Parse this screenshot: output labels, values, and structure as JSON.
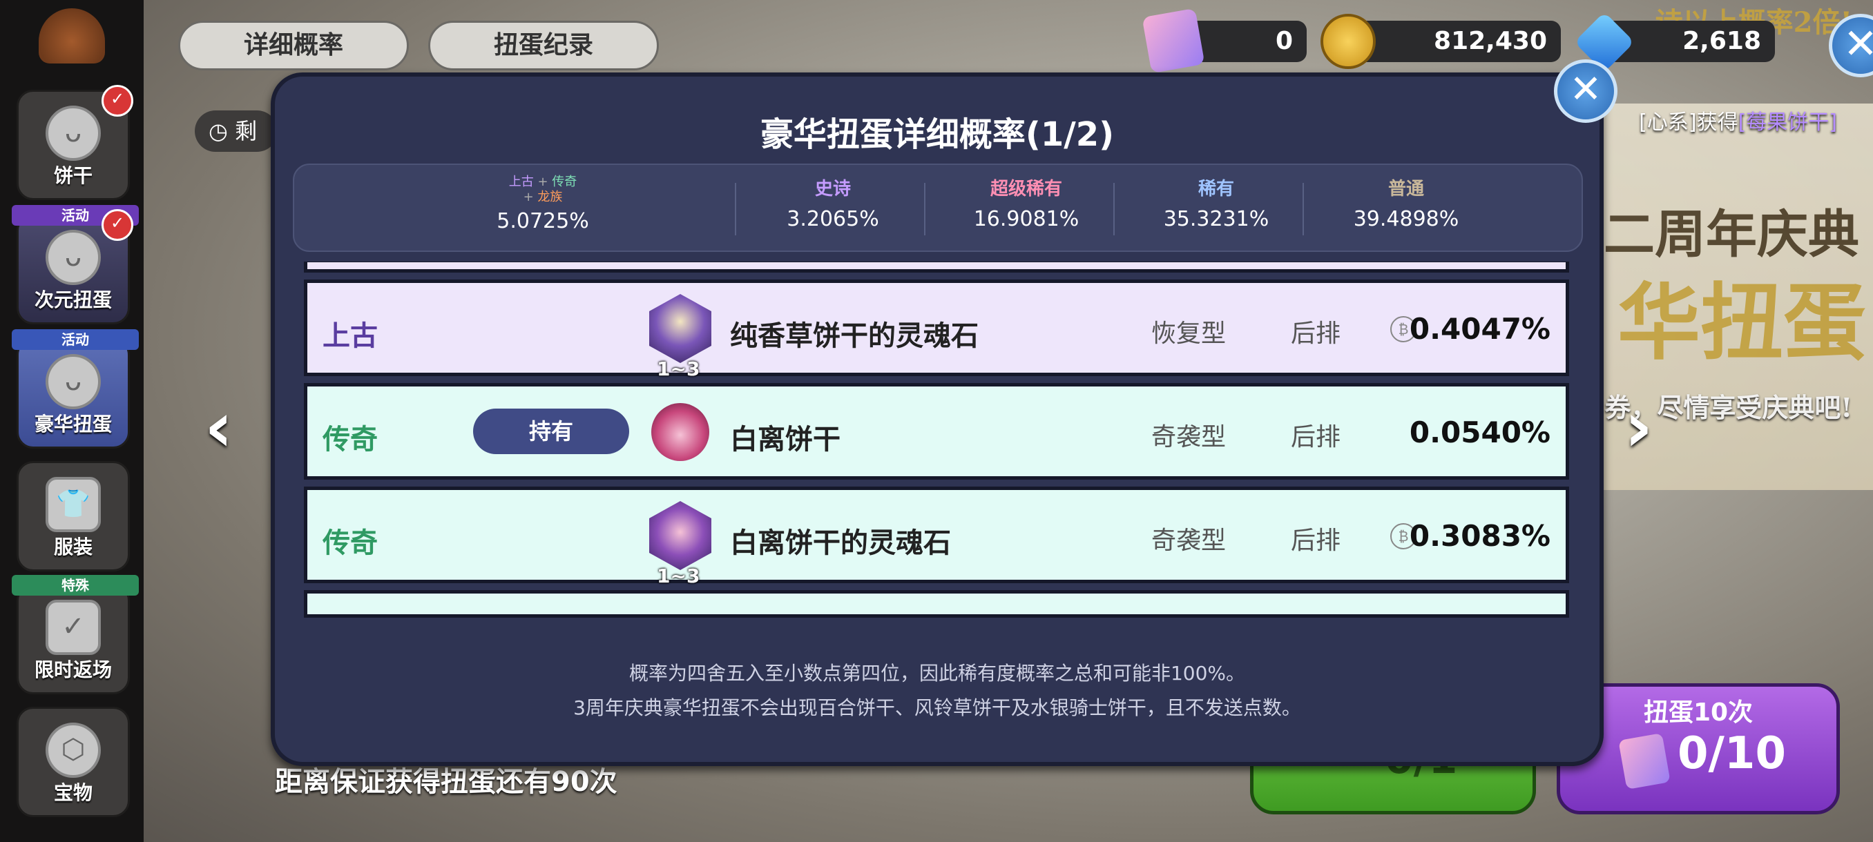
{
  "top_tabs": [
    {
      "label": "详细概率"
    },
    {
      "label": "扭蛋纪录"
    }
  ],
  "currency": {
    "tickets": "0",
    "coins": "812,430",
    "gems": "2,618"
  },
  "sidebar": {
    "items": [
      {
        "label": "饼干",
        "icon": "cookie-icon"
      },
      {
        "label": "次元扭蛋",
        "tag": "活动",
        "icon": "cookie-icon"
      },
      {
        "label": "豪华扭蛋",
        "tag": "活动",
        "icon": "cookie-icon"
      },
      {
        "label": "服装",
        "icon": "shirt-icon"
      },
      {
        "label": "限时返场",
        "tag": "特殊",
        "icon": "shirt-check-icon"
      },
      {
        "label": "宝物",
        "icon": "hexagon-icon"
      }
    ]
  },
  "background": {
    "clock_text": "剩",
    "notice_prefix": "[心系]获得",
    "notice_highlight": "[莓果饼干]",
    "banner_line1": "诗以上概率2倍!",
    "banner_line2": "二周年庆典",
    "banner_line3": "华扭蛋",
    "banner_line4": "券，尽情享受庆典吧!",
    "guarantee_text": "距离保证获得扭蛋还有90次",
    "green_button_count": "0/1",
    "gacha10_label": "扭蛋10次",
    "gacha10_count": "0/10"
  },
  "modal": {
    "title": "豪华扭蛋详细概率(1/2)",
    "stats": [
      {
        "name_parts": [
          "上古",
          "传奇",
          "龙族"
        ],
        "value": "5.0725%"
      },
      {
        "name": "史诗",
        "value": "3.2065%",
        "color": "#c59cff"
      },
      {
        "name": "超级稀有",
        "value": "16.9081%",
        "color": "#ff8fb3"
      },
      {
        "name": "稀有",
        "value": "35.3231%",
        "color": "#9fc4ff"
      },
      {
        "name": "普通",
        "value": "39.4898%",
        "color": "#c9b89a"
      }
    ],
    "rows": [
      {
        "rarity": "上古",
        "owned": "",
        "name": "纯香草饼干的灵魂石",
        "range": "1~3",
        "type": "恢复型",
        "position": "后排",
        "rate": "0.4047%",
        "has_coin": true,
        "icon": "soulstone-icon"
      },
      {
        "rarity": "传奇",
        "owned": "持有",
        "name": "白离饼干",
        "range": "",
        "type": "奇袭型",
        "position": "后排",
        "rate": "0.0540%",
        "has_coin": false,
        "icon": "cookie-portrait-icon"
      },
      {
        "rarity": "传奇",
        "owned": "",
        "name": "白离饼干的灵魂石",
        "range": "1~3",
        "type": "奇袭型",
        "position": "后排",
        "rate": "0.3083%",
        "has_coin": true,
        "icon": "soulstone-icon"
      }
    ],
    "footer_line1": "概率为四舍五入至小数点第四位，因此稀有度概率之总和可能非100%。",
    "footer_line2": "3周年庆典豪华扭蛋不会出现百合饼干、风铃草饼干及水银骑士饼干，且不发送点数。"
  }
}
